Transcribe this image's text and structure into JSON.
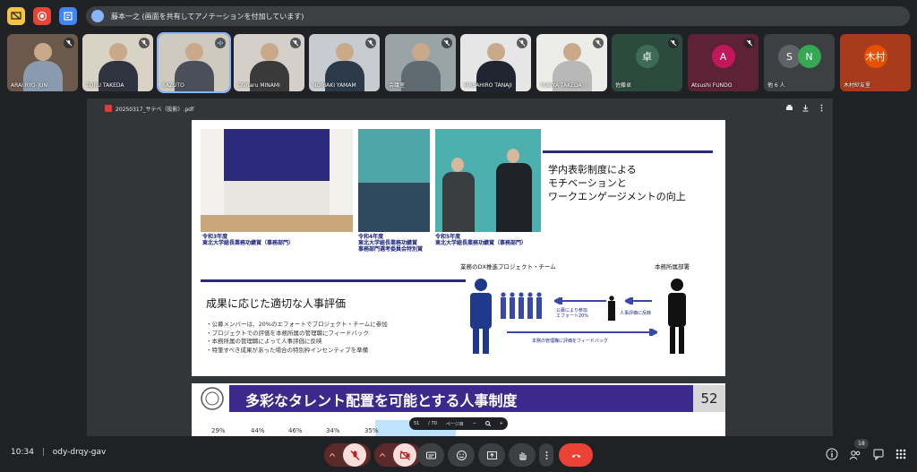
{
  "notice": {
    "text": "藤本一之 (画面を共有してアノテーションを付加しています)"
  },
  "participants": [
    {
      "name": "ARAI RYO-JUN",
      "bg": "#6b5a4c",
      "shirt": "#8a9bb0"
    },
    {
      "name": "TORU TAKEDA",
      "bg": "#d9d3c6",
      "shirt": "#2f3340"
    },
    {
      "name": "KAZUTO",
      "bg": "#cfcac0",
      "shirt": "#4a4f5a"
    },
    {
      "name": "Chiharu MINAMI",
      "bg": "#d4cfc8",
      "shirt": "#3a3a3a"
    },
    {
      "name": "NORIAKI YAMAM",
      "bg": "#c8ccd0",
      "shirt": "#2d3a4a"
    },
    {
      "name": "会議室",
      "bg": "#9aa3a6",
      "shirt": "#5f6b70"
    },
    {
      "name": "MASAHIRO TANAJI",
      "bg": "#e6e6e6",
      "shirt": "#1f2430"
    },
    {
      "name": "YUKIYA TAKEDA（",
      "bg": "#ecece8",
      "shirt": "#b8b8b8"
    }
  ],
  "avatars": [
    {
      "name": "佐藤卓",
      "initial": "卓",
      "bg": "#2d4a3e",
      "circle": "#3d6b57"
    },
    {
      "name": "Atsushi FUNDO",
      "initial": "A",
      "bg": "#5d2235",
      "circle": "#c2185b"
    },
    {
      "name": "他 6 人",
      "initial": "S",
      "initial2": "N",
      "bg": "#3c4043",
      "circle": "#5f6368",
      "circle2": "#34a853"
    },
    {
      "name": "木村紗友里",
      "initial": "木村",
      "bg": "#a93b1d",
      "circle": "#e65100"
    }
  ],
  "viewer": {
    "file_name": "20250317_サテベ（投影）.pdf"
  },
  "slide": {
    "captions": [
      {
        "line1": "令和3年度",
        "line2": "東北大学総長業務功績賞（事務部門）"
      },
      {
        "line1": "令和4年度",
        "line2": "東北大学総長業務功績賞",
        "line3": "事務部門選考委員会特別賞"
      },
      {
        "line1": "令和5年度",
        "line2": "東北大学総長業務功績賞（事務部門）"
      }
    ],
    "heading_right": [
      "学内表彰制度による",
      "モチベーションと",
      "ワークエンゲージメントの向上"
    ],
    "heading_left": "成果に応じた適切な人事評価",
    "bullets": [
      "・公募メンバーは、20%のエフォートでプロジェクト・チームに参加",
      "・プロジェクトでの評価を本務所属の管理職にフィードバック",
      "・本務所属の管理職によって人事評価に反映",
      "・特筆すべき成果があった場合の特別枠インセンティブを準備"
    ],
    "team_label": "業務のDX推進プロジェクト・チーム",
    "dept_label": "本務所属部署",
    "arrow1": "公募により参加",
    "arrow1b": "エフォート20%",
    "arrow2": "人事評価に反映",
    "arrow3": "本務の管理職に評価をフィードバック",
    "next_title": "多彩なタレント配置を可能とする人事制度",
    "page_number": "52",
    "next_row": [
      "29%",
      "44%",
      "46%",
      "34%",
      "35%"
    ]
  },
  "pagebar": {
    "page": "51",
    "total": "/ 70",
    "label": "ページ目"
  },
  "bottom": {
    "time": "10:34",
    "meeting_code": "ody-drqy-gav",
    "people_count": "18"
  }
}
